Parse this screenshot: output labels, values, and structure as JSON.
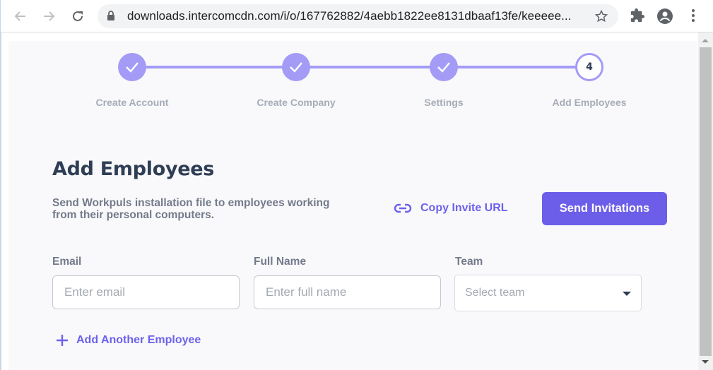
{
  "browser": {
    "url": "downloads.intercomcdn.com/i/o/167762882/4aebb1822ee8131dbaaf13fe/keeeee...",
    "icons": [
      "back-icon",
      "forward-icon",
      "reload-icon",
      "lock-icon",
      "bookmark-star-icon",
      "extensions-icon",
      "profile-icon",
      "menu-icon"
    ]
  },
  "stepper": {
    "steps": [
      {
        "label": "Create Account",
        "state": "completed"
      },
      {
        "label": "Create Company",
        "state": "completed"
      },
      {
        "label": "Settings",
        "state": "completed"
      },
      {
        "label": "Add Employees",
        "state": "current",
        "number": "4"
      }
    ]
  },
  "main": {
    "title": "Add Employees",
    "description": "Send Workpuls installation file to employees working from their personal computers.",
    "copy_invite_label": "Copy Invite URL",
    "send_invitations_label": "Send Invitations",
    "add_another_label": "Add Another Employee"
  },
  "form": {
    "email": {
      "label": "Email",
      "placeholder": "Enter email",
      "value": ""
    },
    "full_name": {
      "label": "Full Name",
      "placeholder": "Enter full name",
      "value": ""
    },
    "team": {
      "label": "Team",
      "placeholder": "Select team"
    }
  },
  "colors": {
    "accent": "#6c5ee8",
    "stepper": "#a39bf6",
    "heading": "#2f3e55",
    "muted": "#737a8a"
  }
}
